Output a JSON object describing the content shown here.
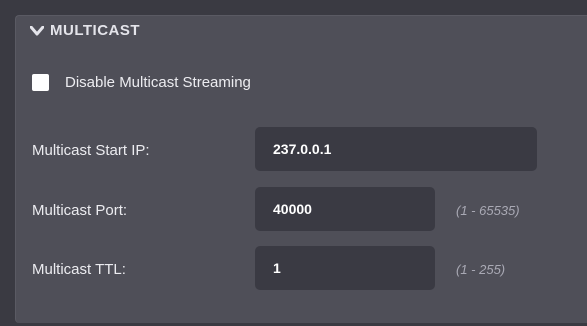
{
  "section": {
    "title": "MULTICAST",
    "icon": "chevron-down-icon"
  },
  "disable_streaming": {
    "label": "Disable Multicast Streaming",
    "checked": false
  },
  "fields": {
    "start_ip": {
      "label": "Multicast Start IP:",
      "value": "237.0.0.1"
    },
    "port": {
      "label": "Multicast Port:",
      "value": "40000",
      "range": "(1 - 65535)"
    },
    "ttl": {
      "label": "Multicast TTL:",
      "value": "1",
      "range": "(1 - 255)"
    }
  },
  "colors": {
    "panel": "#4f4f58",
    "input_bg": "#3a3a43",
    "text": "#ececf0",
    "hint": "#a9a9b4"
  }
}
